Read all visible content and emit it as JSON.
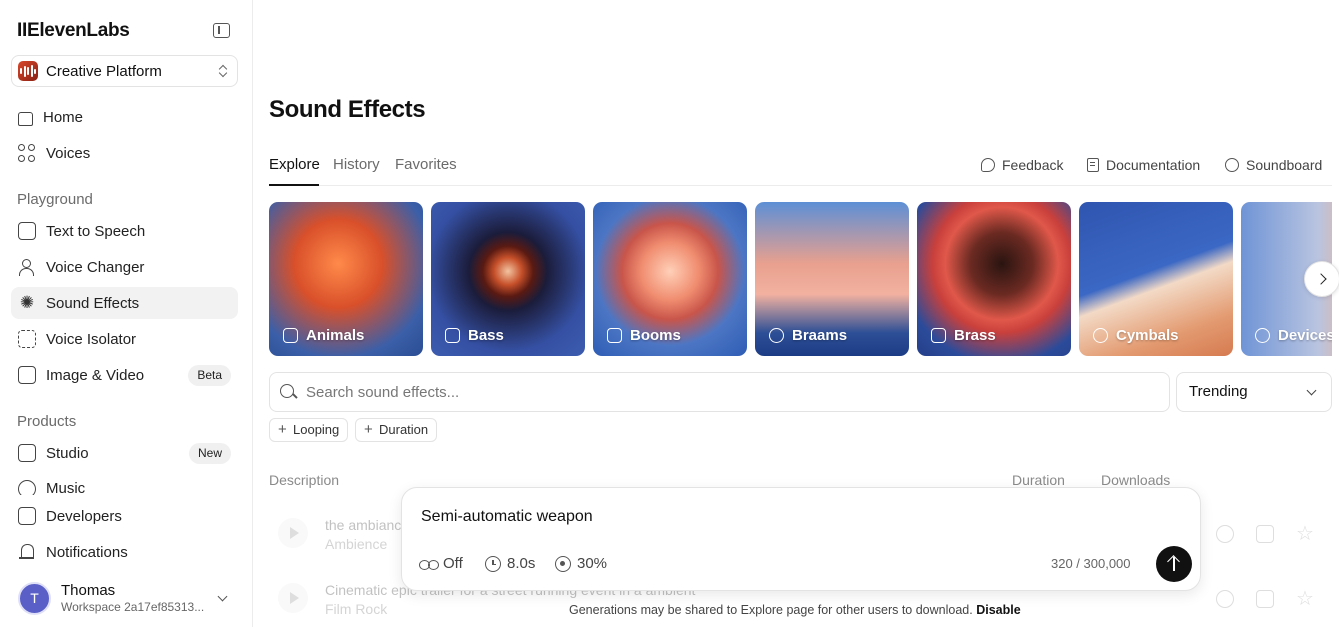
{
  "sidebar": {
    "brand": "IIElevenLabs",
    "workspace_selector": "Creative Platform",
    "nav_top": [
      {
        "label": "Home"
      },
      {
        "label": "Voices"
      }
    ],
    "playground_label": "Playground",
    "playground": [
      {
        "label": "Text to Speech"
      },
      {
        "label": "Voice Changer"
      },
      {
        "label": "Sound Effects"
      },
      {
        "label": "Voice Isolator"
      },
      {
        "label": "Image & Video",
        "badge": "Beta"
      }
    ],
    "products_label": "Products",
    "products": [
      {
        "label": "Studio",
        "badge": "New"
      },
      {
        "label": "Music"
      }
    ],
    "bottom": [
      {
        "label": "Developers"
      },
      {
        "label": "Notifications"
      }
    ],
    "user": {
      "initial": "T",
      "name": "Thomas",
      "workspace": "Workspace 2a17ef85313..."
    }
  },
  "main": {
    "title": "Sound Effects",
    "tabs": [
      {
        "label": "Explore",
        "active": true
      },
      {
        "label": "History"
      },
      {
        "label": "Favorites"
      }
    ],
    "links": [
      {
        "label": "Feedback",
        "icon": "chat-bubble-icon"
      },
      {
        "label": "Documentation",
        "icon": "document-icon"
      },
      {
        "label": "Soundboard",
        "icon": "soundboard-icon"
      }
    ],
    "categories": [
      {
        "label": "Animals",
        "icon": "animals-icon"
      },
      {
        "label": "Bass",
        "icon": "speaker-icon"
      },
      {
        "label": "Booms",
        "icon": "burst-icon"
      },
      {
        "label": "Braams",
        "icon": "alien-icon"
      },
      {
        "label": "Brass",
        "icon": "brass-icon"
      },
      {
        "label": "Cymbals",
        "icon": "cymbal-icon"
      },
      {
        "label": "Devices",
        "icon": "gear-icon"
      }
    ],
    "search": {
      "placeholder": "Search sound effects..."
    },
    "sort": {
      "selected": "Trending"
    },
    "filters": [
      "Looping",
      "Duration"
    ],
    "columns": {
      "description": "Description",
      "duration": "Duration",
      "downloads": "Downloads"
    },
    "rows": [
      {
        "title": "the ambiance",
        "tags": "Ambience"
      },
      {
        "title": "Cinematic epic trailer for a street running event in a ambient",
        "tags": "Film  Rock"
      }
    ]
  },
  "composer": {
    "prompt": "Semi-automatic weapon",
    "loop": "Off",
    "duration": "8.0s",
    "influence": "30%",
    "char_count": "320 / 300,000",
    "notice": "Generations may be shared to Explore page for other users to download.",
    "notice_action": "Disable"
  },
  "colors": {
    "accent": "#111111",
    "avatar": "#5a5fc8",
    "active_nav_bg": "#f2f2f2"
  }
}
